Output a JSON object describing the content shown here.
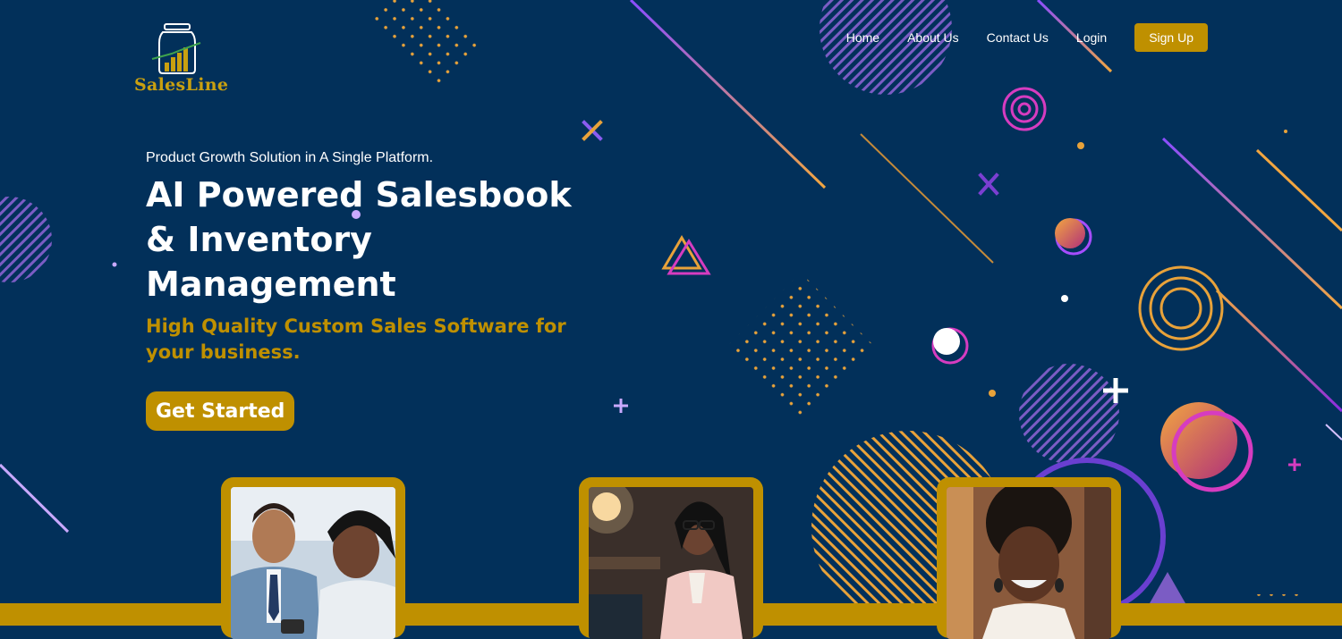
{
  "brand": {
    "name": "SalesLine",
    "logo_icon": "jar-chart-icon"
  },
  "nav": {
    "items": [
      "Home",
      "About Us",
      "Contact Us",
      "Login"
    ],
    "signup_label": "Sign Up"
  },
  "hero": {
    "tagline": "Product Growth Solution in A Single Platform.",
    "headline_lines": [
      "AI Powered Salesbook",
      "& Inventory",
      "Management"
    ],
    "subhead_lines": [
      "High Quality Custom Sales Software for",
      "your business."
    ],
    "cta_label": "Get Started"
  },
  "cards": [
    {
      "image": "man-and-woman-colleagues-photo"
    },
    {
      "image": "woman-with-glasses-office-photo"
    },
    {
      "image": "smiling-woman-portrait-photo"
    }
  ],
  "colors": {
    "background": "#02305a",
    "accent_gold": "#bf9000",
    "accent_purple": "#a64dff",
    "accent_magenta": "#d63cc0",
    "accent_orange": "#e8a23a"
  }
}
